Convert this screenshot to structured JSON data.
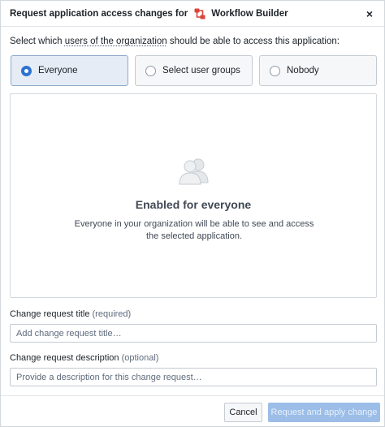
{
  "header": {
    "title_prefix": "Request application access changes for",
    "app_name": "Workflow Builder",
    "close_glyph": "×",
    "app_icon": "workflow-builder-icon",
    "app_icon_color": "#d9453b"
  },
  "prompt": {
    "before": "Select which ",
    "link": "users of the organization",
    "after": " should be able to access this application:"
  },
  "options": [
    {
      "label": "Everyone",
      "selected": true
    },
    {
      "label": "Select user groups",
      "selected": false
    },
    {
      "label": "Nobody",
      "selected": false
    }
  ],
  "panel": {
    "icon": "people-icon",
    "title": "Enabled for everyone",
    "description": "Everyone in your organization will be able to see and access the selected application."
  },
  "form": {
    "title_label": "Change request title",
    "title_hint": "(required)",
    "title_value": "",
    "title_placeholder": "Add change request title…",
    "description_label": "Change request description",
    "description_hint": "(optional)",
    "description_value": "",
    "description_placeholder": "Provide a description for this change request…"
  },
  "footer": {
    "cancel_label": "Cancel",
    "submit_label": "Request and apply change"
  },
  "colors": {
    "accent": "#2d72d2",
    "selected_card_bg": "#e5ecf5",
    "disabled_primary": "#9bbde8"
  }
}
